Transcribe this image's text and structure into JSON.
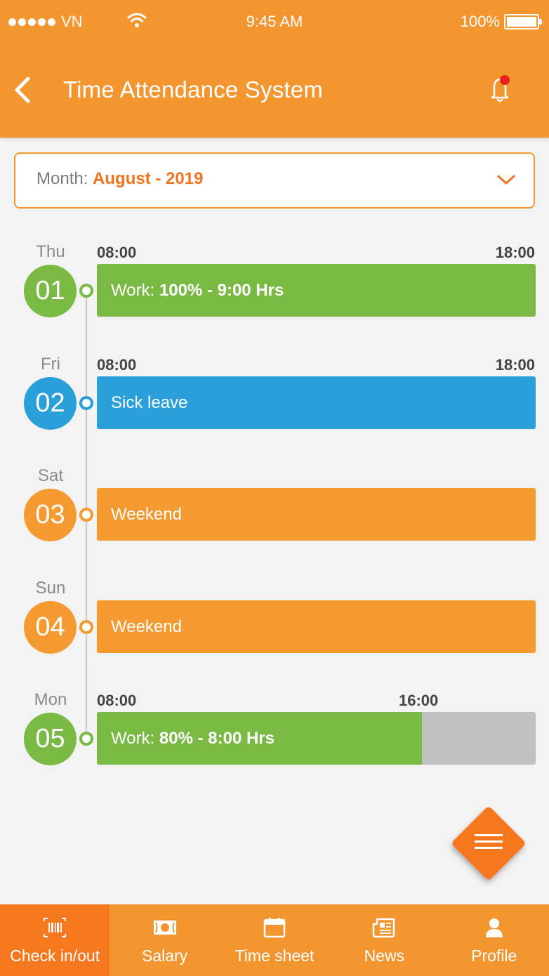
{
  "status_bar": {
    "carrier": "VN",
    "time": "9:45 AM",
    "battery": "100%"
  },
  "header": {
    "title": "Time Attendance System"
  },
  "month_select": {
    "label": "Month: ",
    "value": "August - 2019"
  },
  "days": [
    {
      "dow": "Thu",
      "day": "01",
      "start": "08:00",
      "end": "18:00",
      "type": "work",
      "label": "Work: ",
      "detail": "100% - 9:00 Hrs",
      "percent": 100,
      "color": "#7aba44"
    },
    {
      "dow": "Fri",
      "day": "02",
      "start": "08:00",
      "end": "18:00",
      "type": "leave",
      "label": "Sick leave",
      "detail": "",
      "percent": 100,
      "color": "#2aa0da"
    },
    {
      "dow": "Sat",
      "day": "03",
      "start": "",
      "end": "",
      "type": "weekend",
      "label": "Weekend",
      "detail": "",
      "percent": 100,
      "color": "#f59a30"
    },
    {
      "dow": "Sun",
      "day": "04",
      "start": "",
      "end": "",
      "type": "weekend",
      "label": "Weekend",
      "detail": "",
      "percent": 100,
      "color": "#f59a30"
    },
    {
      "dow": "Mon",
      "day": "05",
      "start": "08:00",
      "end": "16:00",
      "type": "work",
      "label": "Work: ",
      "detail": "80% - 8:00 Hrs",
      "percent": 74,
      "color": "#7aba44"
    }
  ],
  "fab": {
    "icon": "menu-icon"
  },
  "tabs": [
    {
      "label": "Check in/out",
      "icon": "barcode-icon",
      "active": true
    },
    {
      "label": "Salary",
      "icon": "money-icon",
      "active": false
    },
    {
      "label": "Time sheet",
      "icon": "calendar-icon",
      "active": false
    },
    {
      "label": "News",
      "icon": "newspaper-icon",
      "active": false
    },
    {
      "label": "Profile",
      "icon": "person-icon",
      "active": false
    }
  ],
  "colors": {
    "brand": "#f3962f",
    "accent": "#f5781f",
    "work": "#7aba44",
    "leave": "#2aa0da",
    "weekend": "#f59a30",
    "remaining": "#c0c0c0"
  }
}
